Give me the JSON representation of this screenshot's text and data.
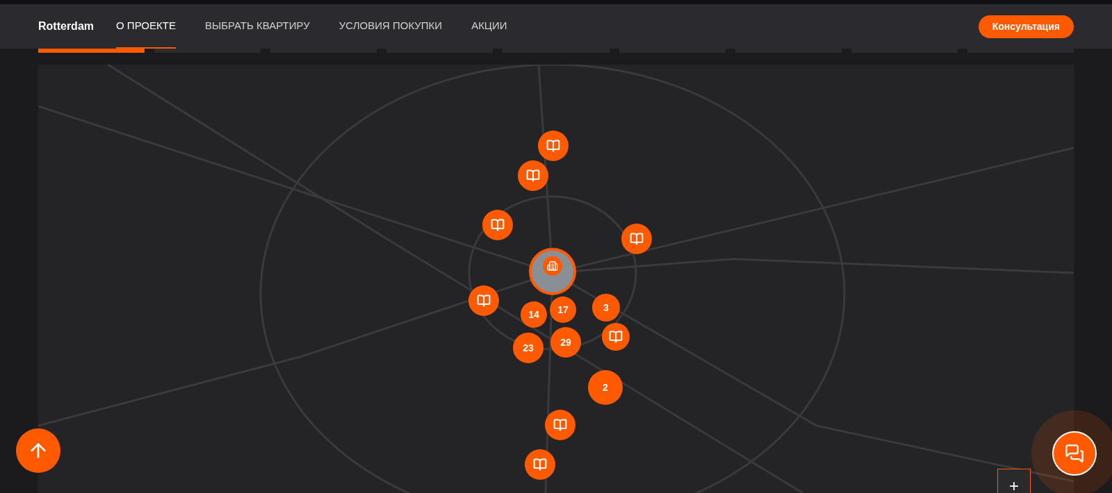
{
  "header": {
    "logo": "Rotterdam",
    "nav": [
      {
        "label": "О ПРОЕКТЕ",
        "selected": true
      },
      {
        "label": "ВЫБРАТЬ КВАРТИРУ",
        "selected": false
      },
      {
        "label": "УСЛОВИЯ ПОКУПКИ",
        "selected": false
      },
      {
        "label": "АКЦИИ",
        "selected": false
      }
    ],
    "cta": "Консультация"
  },
  "section_progress": [
    {
      "selected": true
    },
    {
      "selected": false
    },
    {
      "selected": false
    },
    {
      "selected": false
    },
    {
      "selected": false
    },
    {
      "selected": false
    },
    {
      "selected": false
    },
    {
      "selected": false
    },
    {
      "selected": false
    }
  ],
  "map": {
    "markers": [
      {
        "kind": "book"
      },
      {
        "kind": "book"
      },
      {
        "kind": "book"
      },
      {
        "kind": "book"
      },
      {
        "kind": "photo"
      },
      {
        "kind": "book"
      },
      {
        "kind": "cluster",
        "count": "14"
      },
      {
        "kind": "cluster",
        "count": "17"
      },
      {
        "kind": "cluster",
        "count": "3"
      },
      {
        "kind": "book"
      },
      {
        "kind": "cluster",
        "count": "23"
      },
      {
        "kind": "cluster",
        "count": "29"
      },
      {
        "kind": "cluster",
        "count": "2"
      },
      {
        "kind": "book"
      },
      {
        "kind": "book"
      }
    ],
    "zoom_in": "+"
  }
}
